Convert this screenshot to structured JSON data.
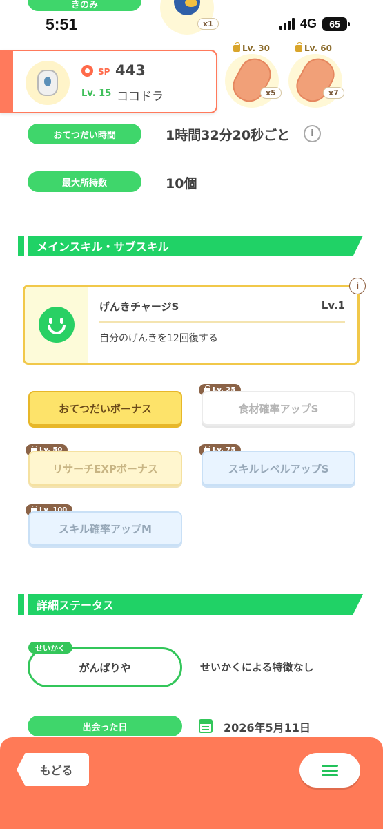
{
  "status_bar": {
    "time": "5:51",
    "network": "4G",
    "battery": "65"
  },
  "top_partial_label": "きのみ",
  "items": [
    {
      "count": "x1"
    },
    {
      "lock_level": "Lv. 30",
      "count": "x5"
    },
    {
      "lock_level": "Lv. 60",
      "count": "x7"
    }
  ],
  "pokemon": {
    "sp_label": "SP",
    "sp_value": "443",
    "level": "Lv. 15",
    "name": "ココドラ"
  },
  "info_rows": {
    "help_time_label": "おてつだい時間",
    "help_time_value": "1時間32分20秒ごと",
    "max_carry_label": "最大所持数",
    "max_carry_value": "10個"
  },
  "main_skill_section": {
    "title": "メインスキル・サブスキル"
  },
  "main_skill": {
    "name": "げんきチャージS",
    "level": "Lv.1",
    "description": "自分のげんきを12回復する"
  },
  "sub_skills": [
    {
      "label": "おてつだいボーナス"
    },
    {
      "label": "食材確率アップS",
      "lock": "Lv. 25"
    },
    {
      "label": "リサーチEXPボーナス",
      "lock": "Lv. 50"
    },
    {
      "label": "スキルレベルアップS",
      "lock": "Lv. 75"
    },
    {
      "label": "スキル確率アップM",
      "lock": "Lv. 100"
    }
  ],
  "detail_section": {
    "title": "詳細ステータス"
  },
  "nature": {
    "tag": "せいかく",
    "value": "がんばりや",
    "description": "せいかくによる特徴なし"
  },
  "met": {
    "label": "出会った日",
    "date": "2026年5月11日"
  },
  "bottom_nav": {
    "back_label": "もどる"
  },
  "colors": {
    "accent_green": "#20d266",
    "accent_orange": "#ff7a57",
    "gold": "#f1c84a"
  }
}
